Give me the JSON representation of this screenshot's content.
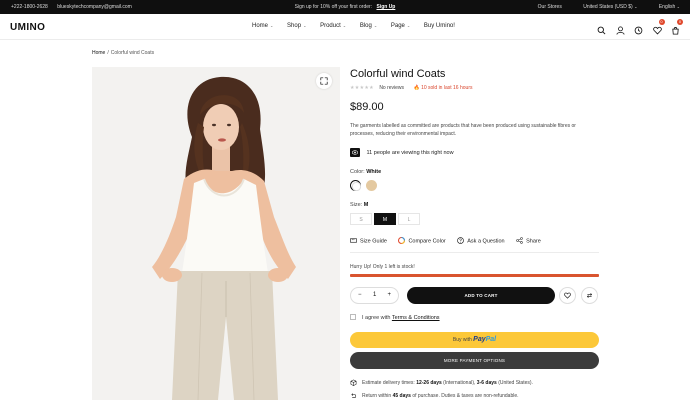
{
  "topbar": {
    "phone": "+222-1800-2628",
    "email": "blueskytechcompany@gmail.com",
    "promo": "Sign up for 10% off your first order:",
    "promo_link": "Sign Up",
    "stores": "Our Stores",
    "region": "United States (USD $)",
    "language": "English"
  },
  "header": {
    "logo": "UMINO",
    "nav": [
      "Home",
      "Shop",
      "Product",
      "Blog",
      "Page",
      "Buy Umino!"
    ],
    "icons": [
      "search-icon",
      "user-icon",
      "compare-icon",
      "wishlist-icon",
      "cart-icon"
    ],
    "wishlist_count": "0",
    "cart_count": "0"
  },
  "breadcrumb": {
    "home": "Home",
    "separator": "/",
    "current": "Colorful wind Coats"
  },
  "product": {
    "title": "Colorful wind Coats",
    "stars": "★★★★★",
    "reviews": "No reviews",
    "sold": "10 sold in last 16 hours",
    "price": "$89.00",
    "description": "The garments labelled as committed are products that have been produced using sustainable fibres or processes, reducing their environmental impact.",
    "viewing": "11 people are viewing this right now",
    "color_label": "Color:",
    "color_value": "White",
    "colors": [
      {
        "name": "White",
        "hex": "#ffffff"
      },
      {
        "name": "Beige",
        "hex": "#e4c9a0"
      }
    ],
    "size_label": "Size:",
    "size_value": "M",
    "sizes": [
      "S",
      "M",
      "L"
    ],
    "selected_size": "M",
    "actions": [
      "Size Guide",
      "Compare Color",
      "Ask a Question",
      "Share"
    ],
    "stock_message": "Hurry Up! Only 1 left is stock!",
    "stock_fraction": 1.0,
    "quantity": "1",
    "minus": "−",
    "plus": "+",
    "add_to_cart": "ADD TO CART",
    "agree_text": "I agree with",
    "terms": "Terms & Conditions",
    "paypal_prefix": "Buy with",
    "paypal_brand_1": "Pay",
    "paypal_brand_2": "Pal",
    "more_payment": "MORE PAYMENT OPTIONS",
    "delivery_prefix": "Estimate delivery times:",
    "delivery_intl": "12-26 days",
    "delivery_intl_label": "(International),",
    "delivery_us": "3-6 days",
    "delivery_us_label": "(United States).",
    "returns_prefix": "Return within",
    "returns_days": "45 days",
    "returns_suffix": "of purchase. Duties & taxes are non-refundable."
  },
  "colors": {
    "accent": "#d9542f",
    "dark": "#111111",
    "paypal": "#fcc839"
  }
}
